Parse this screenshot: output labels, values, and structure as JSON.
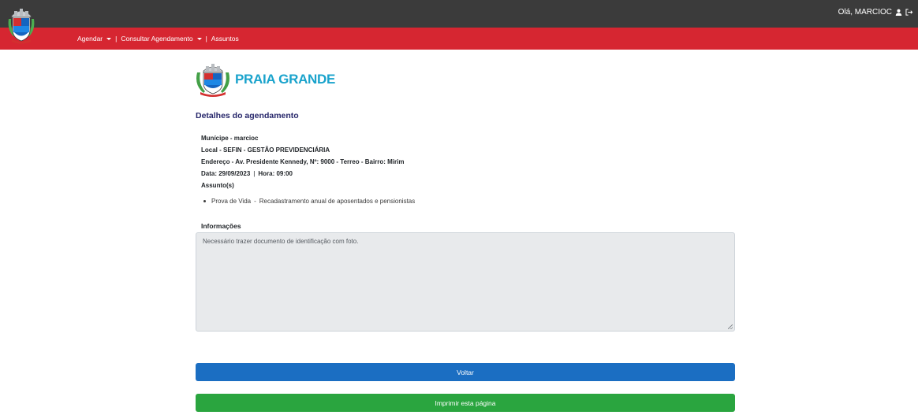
{
  "header": {
    "greeting": "Olá, MARCIOC",
    "user_icon": "user-icon",
    "logout_icon": "logout-icon"
  },
  "nav": {
    "items": [
      {
        "label": "Agendar",
        "has_dropdown": true
      },
      {
        "label": "Consultar Agendamento",
        "has_dropdown": true
      },
      {
        "label": "Assuntos",
        "has_dropdown": false
      }
    ],
    "separator": "|"
  },
  "brand": {
    "name": "PRAIA GRANDE"
  },
  "details": {
    "title": "Detalhes do agendamento",
    "municipe": "Munícipe - marcioc",
    "local": "Local - SEFIN - GESTÃO PREVIDENCIÁRIA",
    "endereco": "Endereço - Av. Presidente Kennedy, Nº: 9000 - Terreo - Bairro: Mirim",
    "data": "Data: 29/09/2023",
    "hora": "Hora: 09:00",
    "assunto_label": "Assunto(s)",
    "assuntos": [
      {
        "name": "Prova de Vida",
        "separator": "-",
        "description": "Recadastramento anual de aposentados e pensionistas"
      }
    ]
  },
  "informacoes": {
    "label": "Informações",
    "text": "Necessário trazer documento de identificação com foto."
  },
  "buttons": {
    "voltar": "Voltar",
    "imprimir": "Imprimir esta página"
  },
  "colors": {
    "topbar": "#3b3b3b",
    "navbar": "#d62631",
    "brand": "#1aa3cc",
    "voltar": "#1b6ec2",
    "imprimir": "#2aa53f"
  }
}
